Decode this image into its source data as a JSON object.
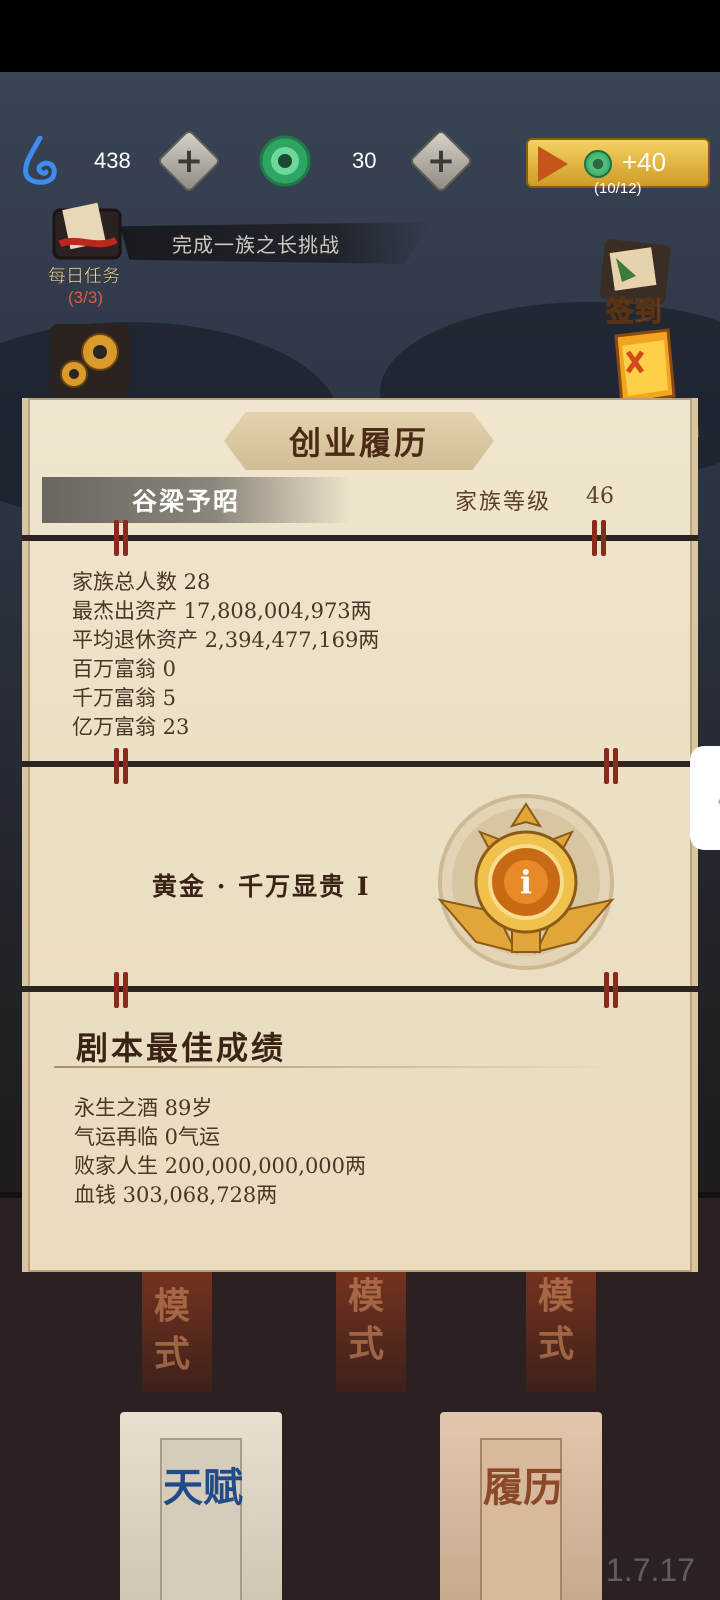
{
  "topbar": {
    "energy_value": "438",
    "jade_value": "30",
    "video_reward_amount": "+40",
    "video_reward_count": "(10/12)"
  },
  "side": {
    "task_banner_text": "完成一族之长挑战",
    "daily_task_label": "每日任务",
    "daily_task_count": "(3/3)",
    "signin_label": "签到"
  },
  "panel": {
    "title": "创业履历",
    "family_name": "谷梁予昭",
    "level_label": "家族等级",
    "level_value": "46",
    "stats": [
      "家族总人数 28",
      "最杰出资产 17,808,004,973两",
      "平均退休资产 2,394,477,169两",
      "百万富翁 0",
      "千万富翁 5",
      "亿万富翁 23"
    ],
    "rank_text": "黄金 · 千万显贵 Ⅰ",
    "best_title": "剧本最佳成绩",
    "best_stats": [
      "永生之酒 89岁",
      "气运再临 0气运",
      "败家人生 200,000,000,000两",
      "血钱 303,068,728两"
    ]
  },
  "bottom": {
    "mode_texts": [
      "模式",
      "模式",
      "模式"
    ],
    "talent_label": "天赋",
    "history_label": "履历",
    "version": "1.7.17"
  },
  "colors": {
    "parchment": "#ece0c5",
    "title_brown": "#4b2a16",
    "text_brown": "#4a3528",
    "accent_gold": "#e0b040"
  },
  "icons": [
    "water-drop-icon",
    "jade-coin-icon",
    "plus-icon",
    "play-icon",
    "scroll-task-icon",
    "gear-icon",
    "signin-scroll-icon",
    "lantern-icon",
    "rank-badge-icon",
    "chevron-left-icon"
  ]
}
